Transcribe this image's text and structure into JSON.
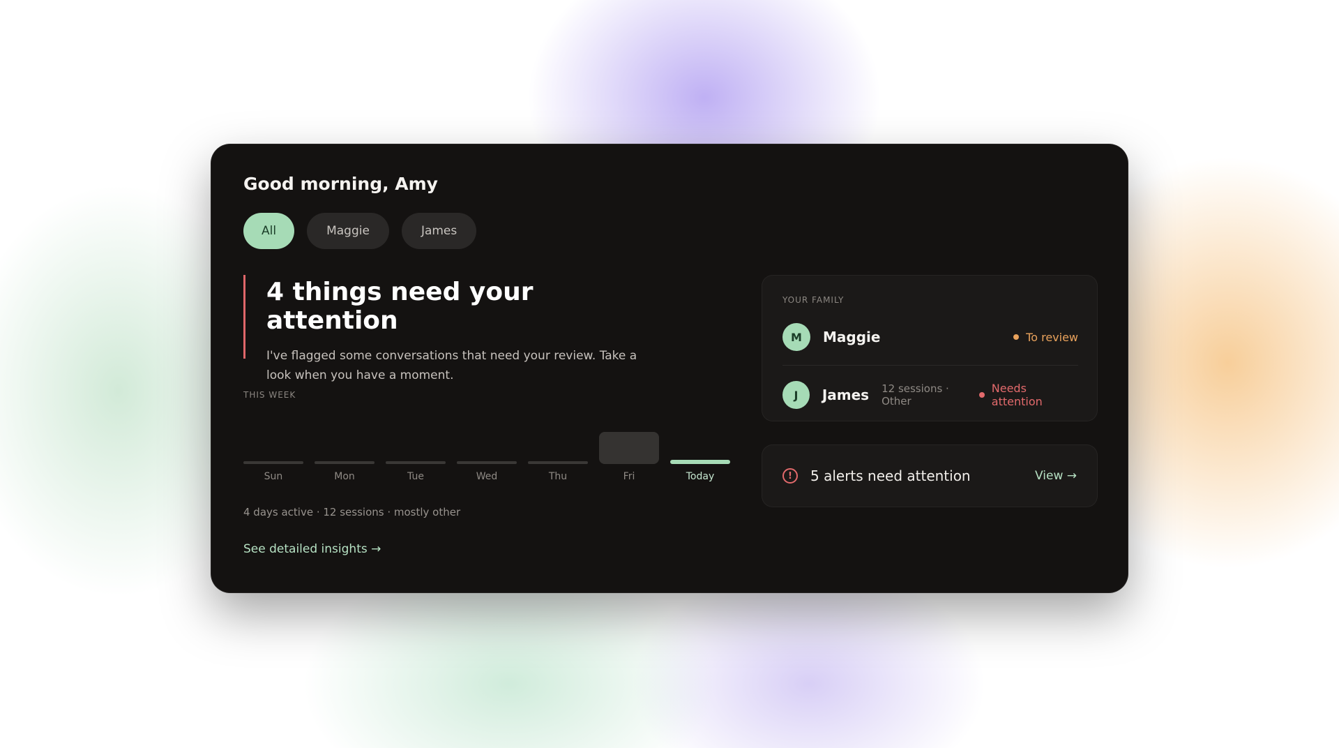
{
  "greeting": "Good morning, Amy",
  "filters": [
    {
      "label": "All",
      "active": true
    },
    {
      "label": "Maggie",
      "active": false
    },
    {
      "label": "James",
      "active": false
    }
  ],
  "attention": {
    "title": "4 things need your attention",
    "body": "I've flagged some conversations that need your review. Take a look when you have a moment."
  },
  "week": {
    "label": "THIS WEEK",
    "days": [
      "Sun",
      "Mon",
      "Tue",
      "Wed",
      "Thu",
      "Fri",
      "Today"
    ],
    "summary": "4 days active · 12 sessions · mostly other",
    "insights_link": "See detailed insights →"
  },
  "family": {
    "label": "YOUR FAMILY",
    "members": [
      {
        "initial": "M",
        "name": "Maggie",
        "meta": "",
        "status": "To review",
        "status_color": "#e9a25c"
      },
      {
        "initial": "J",
        "name": "James",
        "meta": "12 sessions · Other",
        "status": "Needs attention",
        "status_color": "#e36a6c"
      }
    ]
  },
  "alerts": {
    "icon_glyph": "!",
    "text": "5 alerts need attention",
    "link": "View →"
  },
  "colors": {
    "accent": "#a6dbb6",
    "warning": "#e9a25c",
    "danger": "#e36a6c",
    "card_bg": "#141211"
  },
  "icons": {
    "alert": "alert-circle-icon"
  }
}
